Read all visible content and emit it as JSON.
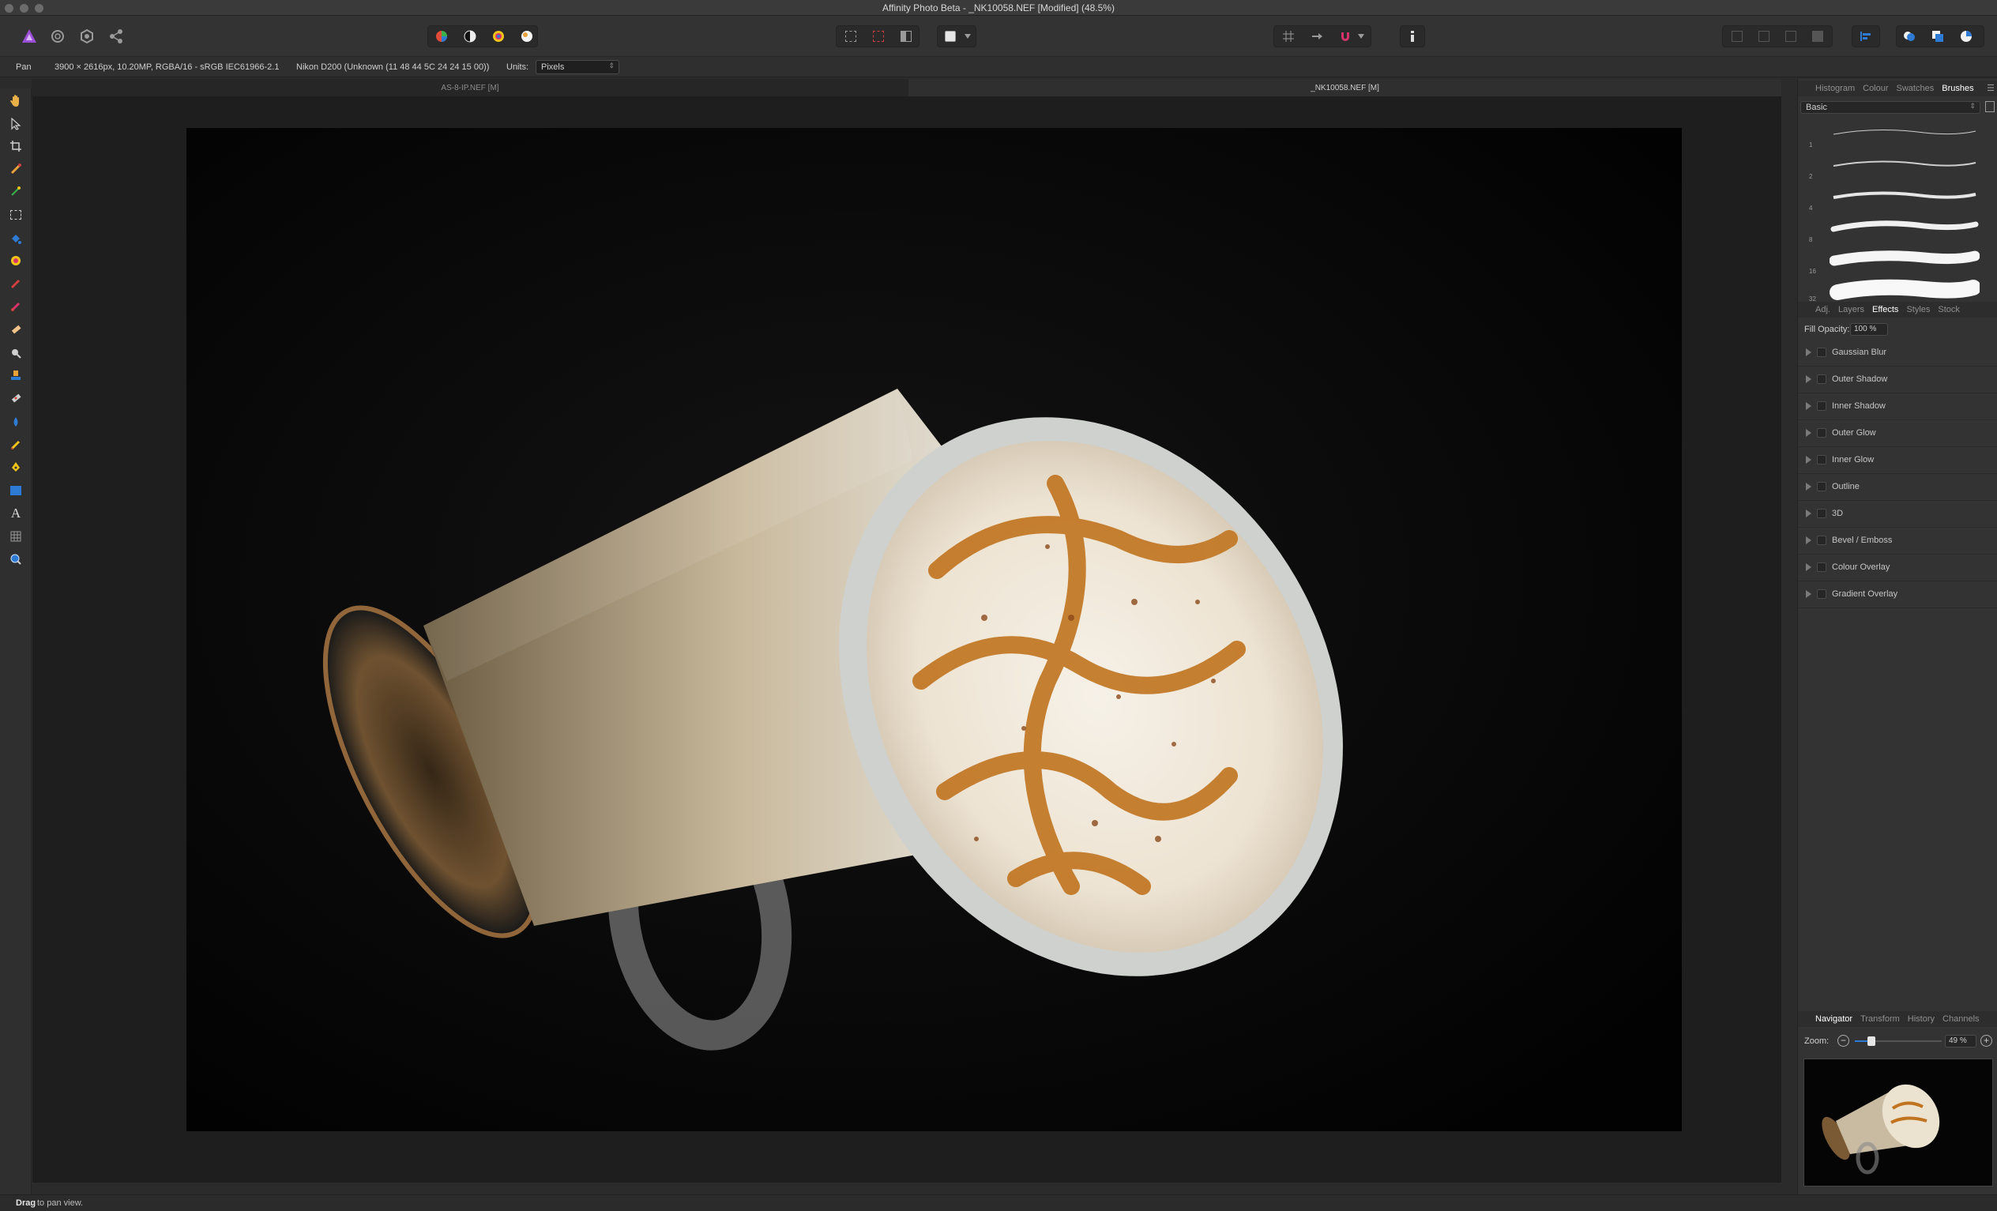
{
  "window": {
    "title": "Affinity Photo Beta - _NK10058.NEF [Modified] (48.5%)"
  },
  "context_bar": {
    "tool_name": "Pan",
    "image_info": "3900 × 2616px, 10.20MP, RGBA/16 - sRGB IEC61966-2.1",
    "camera_info": "Nikon D200 (Unknown (11 48 44 5C 24 24 15 00))",
    "units_label": "Units:",
    "units_value": "Pixels"
  },
  "document_tabs": [
    {
      "label": "AS-8-IP.NEF [M]",
      "active": false
    },
    {
      "label": "_NK10058.NEF [M]",
      "active": true
    }
  ],
  "right_panel": {
    "top_tabs": [
      "Histogram",
      "Colour",
      "Swatches",
      "Brushes"
    ],
    "top_active": "Brushes",
    "brush_category": "Basic",
    "brush_sizes": [
      "1",
      "2",
      "4",
      "8",
      "16",
      "32"
    ],
    "mid_tabs": [
      "Adj.",
      "Layers",
      "Effects",
      "Styles",
      "Stock"
    ],
    "mid_active": "Effects",
    "fill_opacity_label": "Fill Opacity:",
    "fill_opacity_value": "100 %",
    "effects": [
      "Gaussian Blur",
      "Outer Shadow",
      "Inner Shadow",
      "Outer Glow",
      "Inner Glow",
      "Outline",
      "3D",
      "Bevel / Emboss",
      "Colour Overlay",
      "Gradient Overlay"
    ],
    "bottom_tabs": [
      "Navigator",
      "Transform",
      "History",
      "Channels"
    ],
    "bottom_active": "Navigator",
    "zoom_label": "Zoom:",
    "zoom_value": "49 %"
  },
  "status_bar": {
    "bold": "Drag",
    "text": "to pan view."
  },
  "colors": {
    "accent": "#2e7bd6",
    "persona_icon": "#9b4fd6"
  }
}
